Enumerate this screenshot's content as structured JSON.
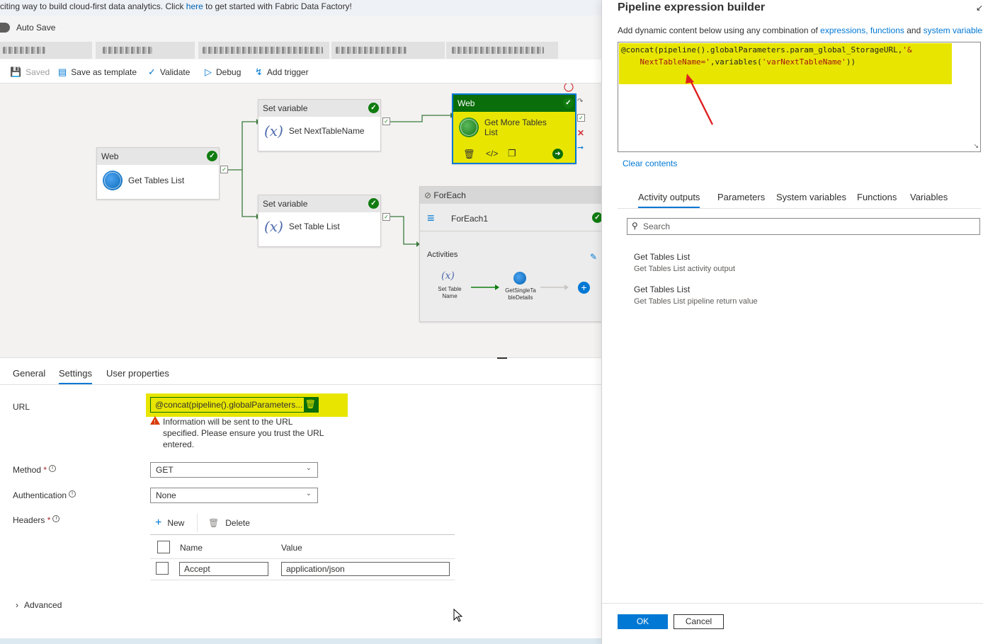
{
  "banner": {
    "text_before": "citing way to build cloud-first data analytics. Click ",
    "link": "here",
    "text_after": " to get started with Fabric Data Factory!"
  },
  "autosave": {
    "label": "Auto Save"
  },
  "toolbar": {
    "saved": "Saved",
    "save_as_template": "Save as template",
    "validate": "Validate",
    "debug": "Debug",
    "add_trigger": "Add trigger"
  },
  "canvas": {
    "web1": {
      "type": "Web",
      "name": "Get Tables List"
    },
    "setvar1": {
      "type": "Set variable",
      "name": "Set NextTableName"
    },
    "setvar2": {
      "type": "Set variable",
      "name": "Set Table List"
    },
    "web2": {
      "type": "Web",
      "name": "Get More Tables List"
    },
    "foreach": {
      "type": "ForEach",
      "name": "ForEach1",
      "activities_label": "Activities",
      "inner1": "Set Table Name",
      "inner2": "GetSingleTableDetails"
    }
  },
  "bottom": {
    "tabs": [
      "General",
      "Settings",
      "User properties"
    ],
    "active_tab": "Settings",
    "url_label": "URL",
    "url_value": "@concat(pipeline().globalParameters...",
    "warning": "Information will be sent to the URL specified. Please ensure you trust the URL entered.",
    "method_label": "Method",
    "method_value": "GET",
    "auth_label": "Authentication",
    "auth_value": "None",
    "headers_label": "Headers",
    "new_label": "New",
    "delete_label": "Delete",
    "col_name": "Name",
    "col_value": "Value",
    "header_name": "Accept",
    "header_value": "application/json",
    "advanced": "Advanced"
  },
  "panel": {
    "title": "Pipeline expression builder",
    "sub_before": "Add dynamic content below using any combination of ",
    "sub_link1": "expressions, functions",
    "sub_mid": " and ",
    "sub_link2": "system variables.",
    "expression_line1_a": "@concat(pipeline().globalParameters.param_global_StorageURL,",
    "expression_line1_b": "'&",
    "expression_line2_a": "NextTableName='",
    "expression_line2_b": ",variables(",
    "expression_line2_c": "'varNextTableName'",
    "expression_line2_d": "))",
    "clear": "Clear contents",
    "tabs": [
      "Activity outputs",
      "Parameters",
      "System variables",
      "Functions",
      "Variables"
    ],
    "active_tab": "Activity outputs",
    "search_placeholder": "Search",
    "outputs": [
      {
        "title": "Get Tables List",
        "sub": "Get Tables List activity output"
      },
      {
        "title": "Get Tables List",
        "sub": "Get Tables List pipeline return value"
      }
    ],
    "ok": "OK",
    "cancel": "Cancel"
  }
}
